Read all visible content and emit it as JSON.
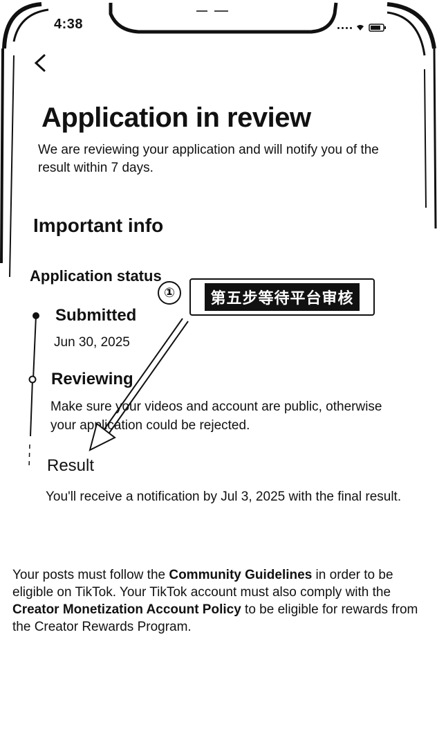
{
  "status_bar": {
    "time": "4:38"
  },
  "header": {
    "back_icon": "chevron-left-icon"
  },
  "main": {
    "title": "Application in review",
    "subtitle": "We are reviewing your application and will notify you of the result within 7 days.",
    "important_info_heading": "Important info",
    "application_status_heading": "Application status",
    "steps": [
      {
        "title": "Submitted",
        "date": "Jun 30, 2025"
      },
      {
        "title": "Reviewing",
        "text": "Make sure your videos and account are public, otherwise your application could be rejected."
      },
      {
        "title": "Result",
        "text": "You'll receive a notification by Jul 3, 2025 with the final result."
      }
    ]
  },
  "annotation": {
    "number": "①",
    "label": "第五步等待平台审核"
  },
  "footer": {
    "text_1": "Your posts must follow the ",
    "link_1": "Community Guidelines",
    "text_2": " in order to be eligible on TikTok. Your TikTok account must also comply with the ",
    "link_2": "Creator Monetization Account Policy",
    "text_3": " to be eligible for rewards from the Creator Rewards Program."
  },
  "colors": {
    "text": "#111111",
    "background": "#ffffff"
  }
}
